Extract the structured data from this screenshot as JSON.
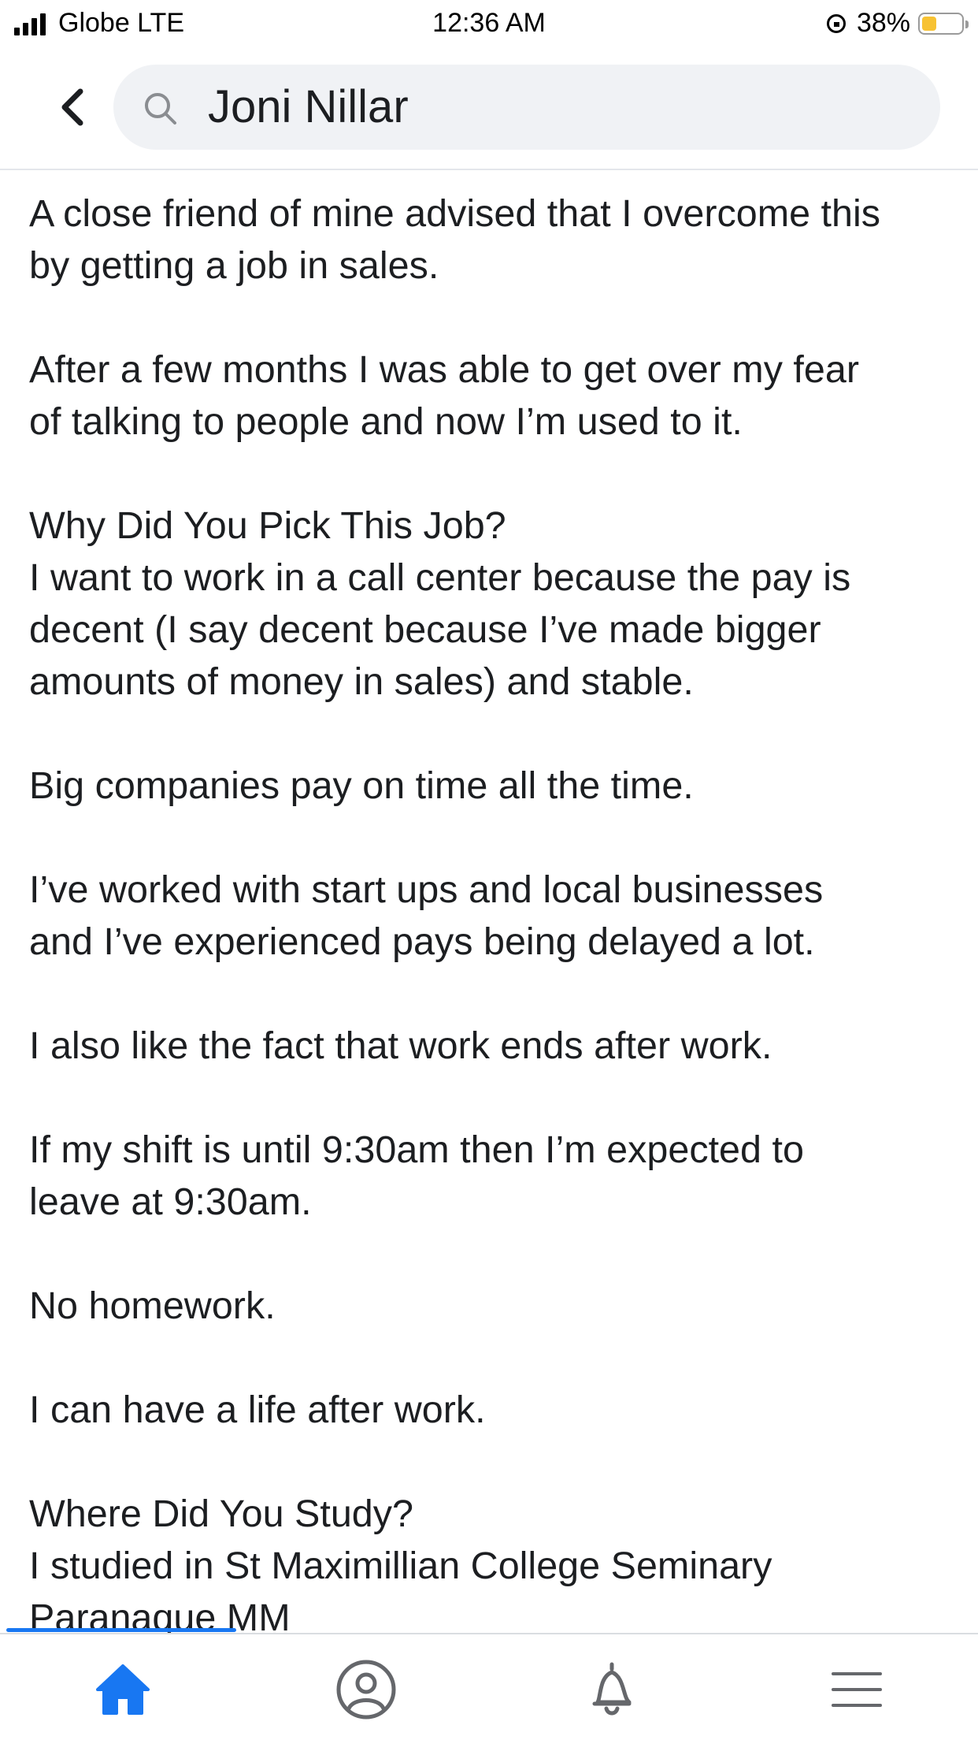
{
  "status_bar": {
    "carrier": "Globe LTE",
    "time": "12:36 AM",
    "battery_percent": "38%",
    "battery_level": 0.38,
    "battery_color": "#f7c233"
  },
  "header": {
    "back_icon": "chevron-left-icon",
    "search_icon": "search-icon",
    "search_value": "Joni Nillar"
  },
  "post": {
    "paragraphs": [
      [
        "A close friend of mine advised that I overcome this",
        "by getting a job in sales."
      ],
      [
        "After a few months I was able to get over my fear",
        "of talking to people and now I’m used to it."
      ],
      [
        "Why Did You Pick This Job?",
        "I want to work in a call center because the pay is",
        "decent (I say decent because I’ve made bigger",
        "amounts of money in sales) and stable."
      ],
      [
        "Big companies pay on time all the time."
      ],
      [
        "I’ve worked with start ups and local businesses",
        "and I’ve experienced pays being delayed a lot."
      ],
      [
        "I also like the fact that work ends after work."
      ],
      [
        "If my shift is until 9:30am then I’m expected to",
        "leave at 9:30am."
      ],
      [
        "No homework."
      ],
      [
        "I can have a life after work."
      ],
      [
        "Where Did You Study?",
        "I studied in St Maximillian College Seminary",
        "Paranaque MM"
      ]
    ]
  },
  "bottom_nav": {
    "items": [
      {
        "icon": "home-icon",
        "active": true
      },
      {
        "icon": "profile-icon",
        "active": false
      },
      {
        "icon": "bell-icon",
        "active": false
      },
      {
        "icon": "menu-icon",
        "active": false
      }
    ],
    "accent_color": "#1877f2",
    "icon_color": "#65676b"
  }
}
